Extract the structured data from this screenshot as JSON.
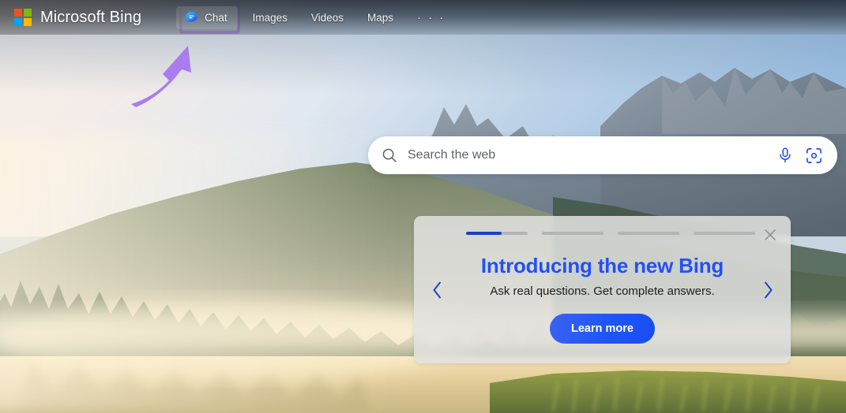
{
  "header": {
    "brand": "Microsoft Bing",
    "logo_icon": "microsoft-logo-icon",
    "logo_colors": [
      "#F25022",
      "#7FBA00",
      "#00A4EF",
      "#FFB900"
    ],
    "nav": [
      {
        "label": "Chat",
        "icon": "chat-bubble-icon",
        "active": true
      },
      {
        "label": "Images",
        "icon": "",
        "active": false
      },
      {
        "label": "Videos",
        "icon": "",
        "active": false
      },
      {
        "label": "Maps",
        "icon": "",
        "active": false
      },
      {
        "label": "· · ·",
        "icon": "more-ellipsis-icon",
        "active": false
      }
    ]
  },
  "annotations": {
    "highlight_color": "#b37cf5",
    "arrow_color": "#a876f0",
    "highlight_target": "Chat",
    "arrow_name": "curved-arrow-annotation"
  },
  "search": {
    "placeholder": "Search the web",
    "value": "",
    "search_icon": "magnifier-icon",
    "mic_icon": "microphone-icon",
    "visual_icon": "visual-search-camera-icon",
    "accent": "#174AE4"
  },
  "promo": {
    "title": "Introducing the new Bing",
    "subtitle": "Ask real questions. Get complete answers.",
    "button_label": "Learn more",
    "close_icon": "close-x-icon",
    "prev_icon": "chevron-left-icon",
    "next_icon": "chevron-right-icon",
    "title_color": "#2350f6",
    "button_color": "#1f55f5",
    "progress": [
      {
        "fill_percent": 58,
        "active": true
      },
      {
        "fill_percent": 0,
        "active": false
      },
      {
        "fill_percent": 0,
        "active": false
      },
      {
        "fill_percent": 0,
        "active": false
      }
    ]
  },
  "background": {
    "scene": "misty-lake-sunrise-mountains-photo",
    "sky_left": "#f7ece4",
    "sky_right": "#9dc2e6"
  }
}
